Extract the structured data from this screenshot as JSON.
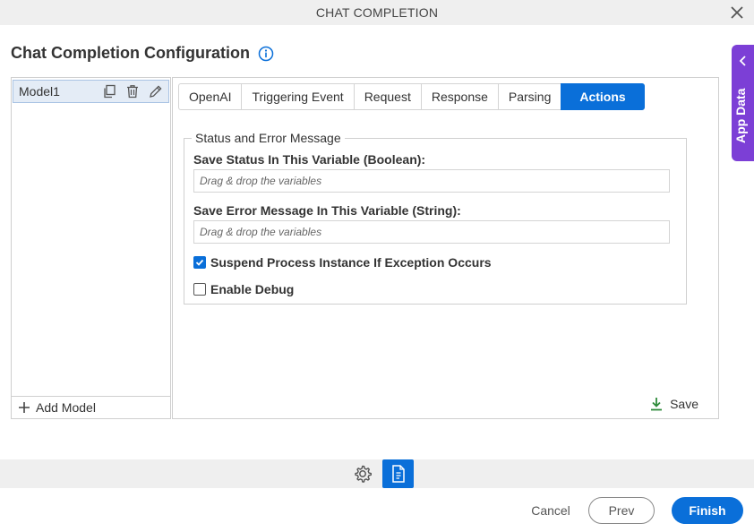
{
  "dialog": {
    "title": "CHAT COMPLETION",
    "heading": "Chat Completion Configuration"
  },
  "side_tab": {
    "label": "App Data"
  },
  "models": {
    "items": [
      {
        "label": "Model1"
      }
    ],
    "add_label": "Add Model"
  },
  "tabs": [
    {
      "label": "OpenAI"
    },
    {
      "label": "Triggering Event"
    },
    {
      "label": "Request"
    },
    {
      "label": "Response"
    },
    {
      "label": "Parsing"
    },
    {
      "label": "Actions",
      "active": true
    }
  ],
  "actions": {
    "section_title": "Status and Error Message",
    "status_label": "Save Status In This Variable (Boolean):",
    "status_placeholder": "Drag & drop the variables",
    "error_label": "Save Error Message In This Variable (String):",
    "error_placeholder": "Drag & drop the variables",
    "suspend_label": "Suspend Process Instance If Exception Occurs",
    "suspend_checked": true,
    "debug_label": "Enable Debug",
    "debug_checked": false,
    "save_label": "Save"
  },
  "footer": {
    "cancel": "Cancel",
    "prev": "Prev",
    "finish": "Finish"
  },
  "colors": {
    "accent": "#0a6fd9",
    "side_tab": "#7c3fd6",
    "save_icon": "#2e8b3a"
  },
  "icons": {
    "close": "close-icon",
    "info": "info-icon",
    "chevron": "chevron-left-icon",
    "copy": "copy-icon",
    "delete": "trash-icon",
    "edit": "pencil-icon",
    "plus": "plus-icon",
    "save": "download-icon",
    "settings": "gear-icon",
    "document": "document-icon"
  }
}
